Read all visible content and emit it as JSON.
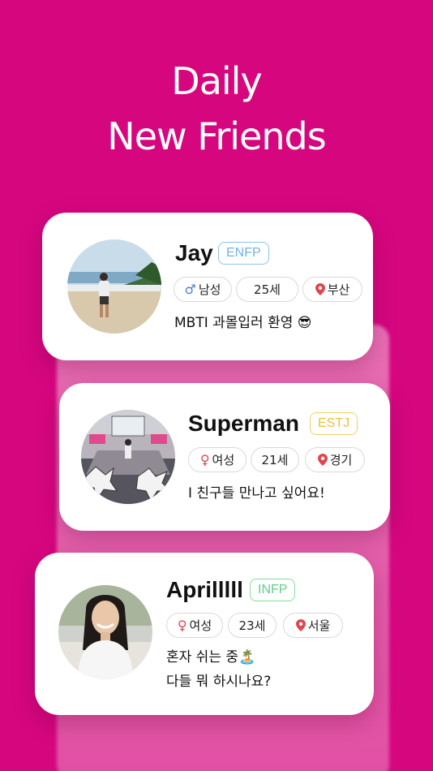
{
  "headline": {
    "line1": "Daily",
    "line2": "New Friends"
  },
  "colors": {
    "background": "#d6067f",
    "enfp": "#6fb3e6",
    "estj": "#e8c43a",
    "infp": "#5fcf86",
    "male": "#4a7fd6",
    "female": "#e0454f",
    "pin": "#e0454f"
  },
  "cards": [
    {
      "name": "Jay",
      "mbti": "ENFP",
      "gender_symbol": "♂",
      "gender": "남성",
      "age": "25세",
      "location": "부산",
      "bio_line1": "MBTI 과몰입러 환영 😎",
      "bio_line2": ""
    },
    {
      "name": "Superman",
      "mbti": "ESTJ",
      "gender_symbol": "♀",
      "gender": "여성",
      "age": "21세",
      "location": "경기",
      "bio_line1": "I 친구들 만나고 싶어요!",
      "bio_line2": ""
    },
    {
      "name": "Aprilllll",
      "mbti": "INFP",
      "gender_symbol": "♀",
      "gender": "여성",
      "age": "23세",
      "location": "서울",
      "bio_line1": "혼자 쉬는 중🏝️",
      "bio_line2": "다들 뭐 하시나요?"
    }
  ]
}
